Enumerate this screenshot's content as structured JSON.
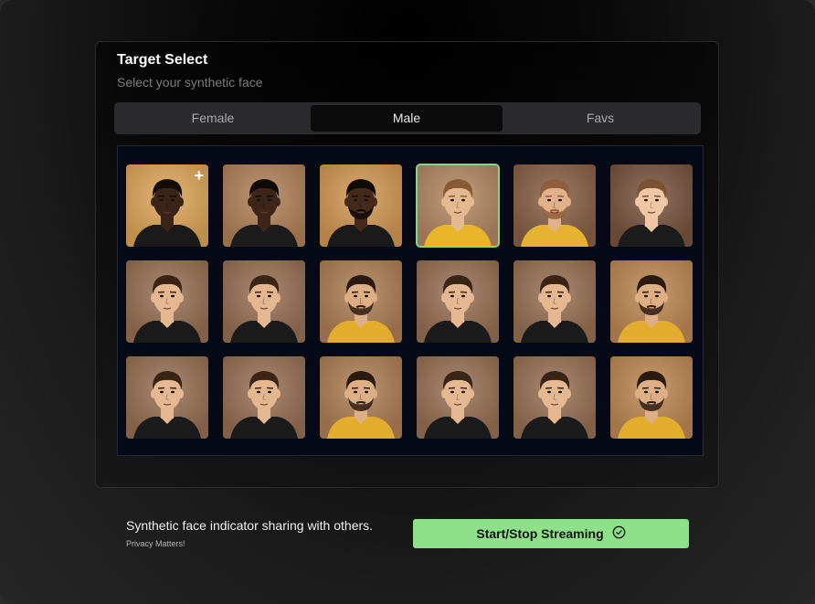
{
  "header": {
    "title": "Target Select",
    "subtitle": "Select your synthetic face"
  },
  "tabs": [
    {
      "label": "Female",
      "active": false
    },
    {
      "label": "Male",
      "active": true
    },
    {
      "label": "Favs",
      "active": false
    }
  ],
  "add_icon_glyph": "+",
  "faces": [
    {
      "skin": "#3a2418",
      "hair": "#120b07",
      "shirt": "#1a1a1a",
      "bg": "#e0a85a",
      "add": true
    },
    {
      "skin": "#3d2519",
      "hair": "#0f0907",
      "shirt": "#1c1c1c",
      "bg": "#b4845a"
    },
    {
      "skin": "#45291b",
      "hair": "#100a07",
      "shirt": "#1a1a1a",
      "bg": "#d59a55",
      "beard": true
    },
    {
      "skin": "#e5b98f",
      "hair": "#8a5a35",
      "shirt": "#e8b42a",
      "bg": "#b58a64",
      "selected": true
    },
    {
      "skin": "#e2b089",
      "hair": "#8f5e3a",
      "shirt": "#e6b232",
      "bg": "#8a6248",
      "beard": true
    },
    {
      "skin": "#efc7a4",
      "hair": "#7a5232",
      "shirt": "#1c1c1c",
      "bg": "#7a5640"
    },
    {
      "skin": "#e6b892",
      "hair": "#3a2416",
      "shirt": "#1b1b1b",
      "bg": "#9a7256"
    },
    {
      "skin": "#e5b790",
      "hair": "#3b2517",
      "shirt": "#1b1b1b",
      "bg": "#9a7256"
    },
    {
      "skin": "#deaf85",
      "hair": "#2a1a10",
      "shirt": "#e2ad2c",
      "bg": "#b08055",
      "beard": true
    },
    {
      "skin": "#e6b892",
      "hair": "#3a2416",
      "shirt": "#1b1b1b",
      "bg": "#9a7256"
    },
    {
      "skin": "#e6b892",
      "hair": "#3a2416",
      "shirt": "#1b1b1b",
      "bg": "#9a7256"
    },
    {
      "skin": "#deaf85",
      "hair": "#2a1a10",
      "shirt": "#e2ad2c",
      "bg": "#c08a55",
      "beard": true
    },
    {
      "skin": "#e6b892",
      "hair": "#3a2416",
      "shirt": "#1b1b1b",
      "bg": "#9a7256"
    },
    {
      "skin": "#e5b790",
      "hair": "#3b2517",
      "shirt": "#1b1b1b",
      "bg": "#9a7256"
    },
    {
      "skin": "#deaf85",
      "hair": "#2a1a10",
      "shirt": "#e2ad2c",
      "bg": "#b08055",
      "beard": true
    },
    {
      "skin": "#e6b892",
      "hair": "#3a2416",
      "shirt": "#1b1b1b",
      "bg": "#9a7256"
    },
    {
      "skin": "#e6b892",
      "hair": "#3a2416",
      "shirt": "#1b1b1b",
      "bg": "#9a7256"
    },
    {
      "skin": "#deaf85",
      "hair": "#2a1a10",
      "shirt": "#e2ad2c",
      "bg": "#c08a55",
      "beard": true
    }
  ],
  "footer": {
    "message": "Synthetic face indicator sharing with others.",
    "note": "Privacy Matters!",
    "stream_button_label": "Start/Stop Streaming",
    "stream_button_icon": "check-circle-icon"
  },
  "colors": {
    "accent": "#8ee089",
    "selected_border": "#7fd68c"
  }
}
